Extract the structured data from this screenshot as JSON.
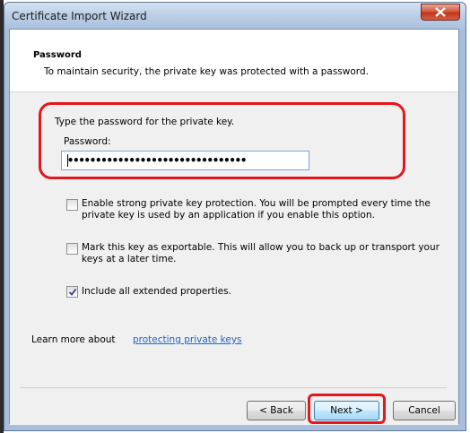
{
  "window": {
    "title": "Certificate Import Wizard"
  },
  "header": {
    "title": "Password",
    "description": "To maintain security, the private key was protected with a password."
  },
  "password_section": {
    "instruction": "Type the password for the private key.",
    "field_label": "Password:",
    "value": "••••••••••••••••••••••••••••••••"
  },
  "options": [
    {
      "label_line1": "Enable strong private key protection. You will be prompted every time the",
      "label_line2": "private key is used by an application if you enable this option.",
      "checked": false
    },
    {
      "label_line1": "Mark this key as exportable. This will allow you to back up or transport your",
      "label_line2": "keys at a later time.",
      "checked": false
    },
    {
      "label_line1": "Include all extended properties.",
      "label_line2": "",
      "checked": true
    }
  ],
  "learn_more": {
    "prefix": "Learn more about ",
    "link": "protecting private keys"
  },
  "buttons": {
    "back": "< Back",
    "next": "Next >",
    "cancel": "Cancel"
  },
  "colors": {
    "highlight": "#e5161d",
    "link": "#1c62c4",
    "close": "#c2331b"
  }
}
